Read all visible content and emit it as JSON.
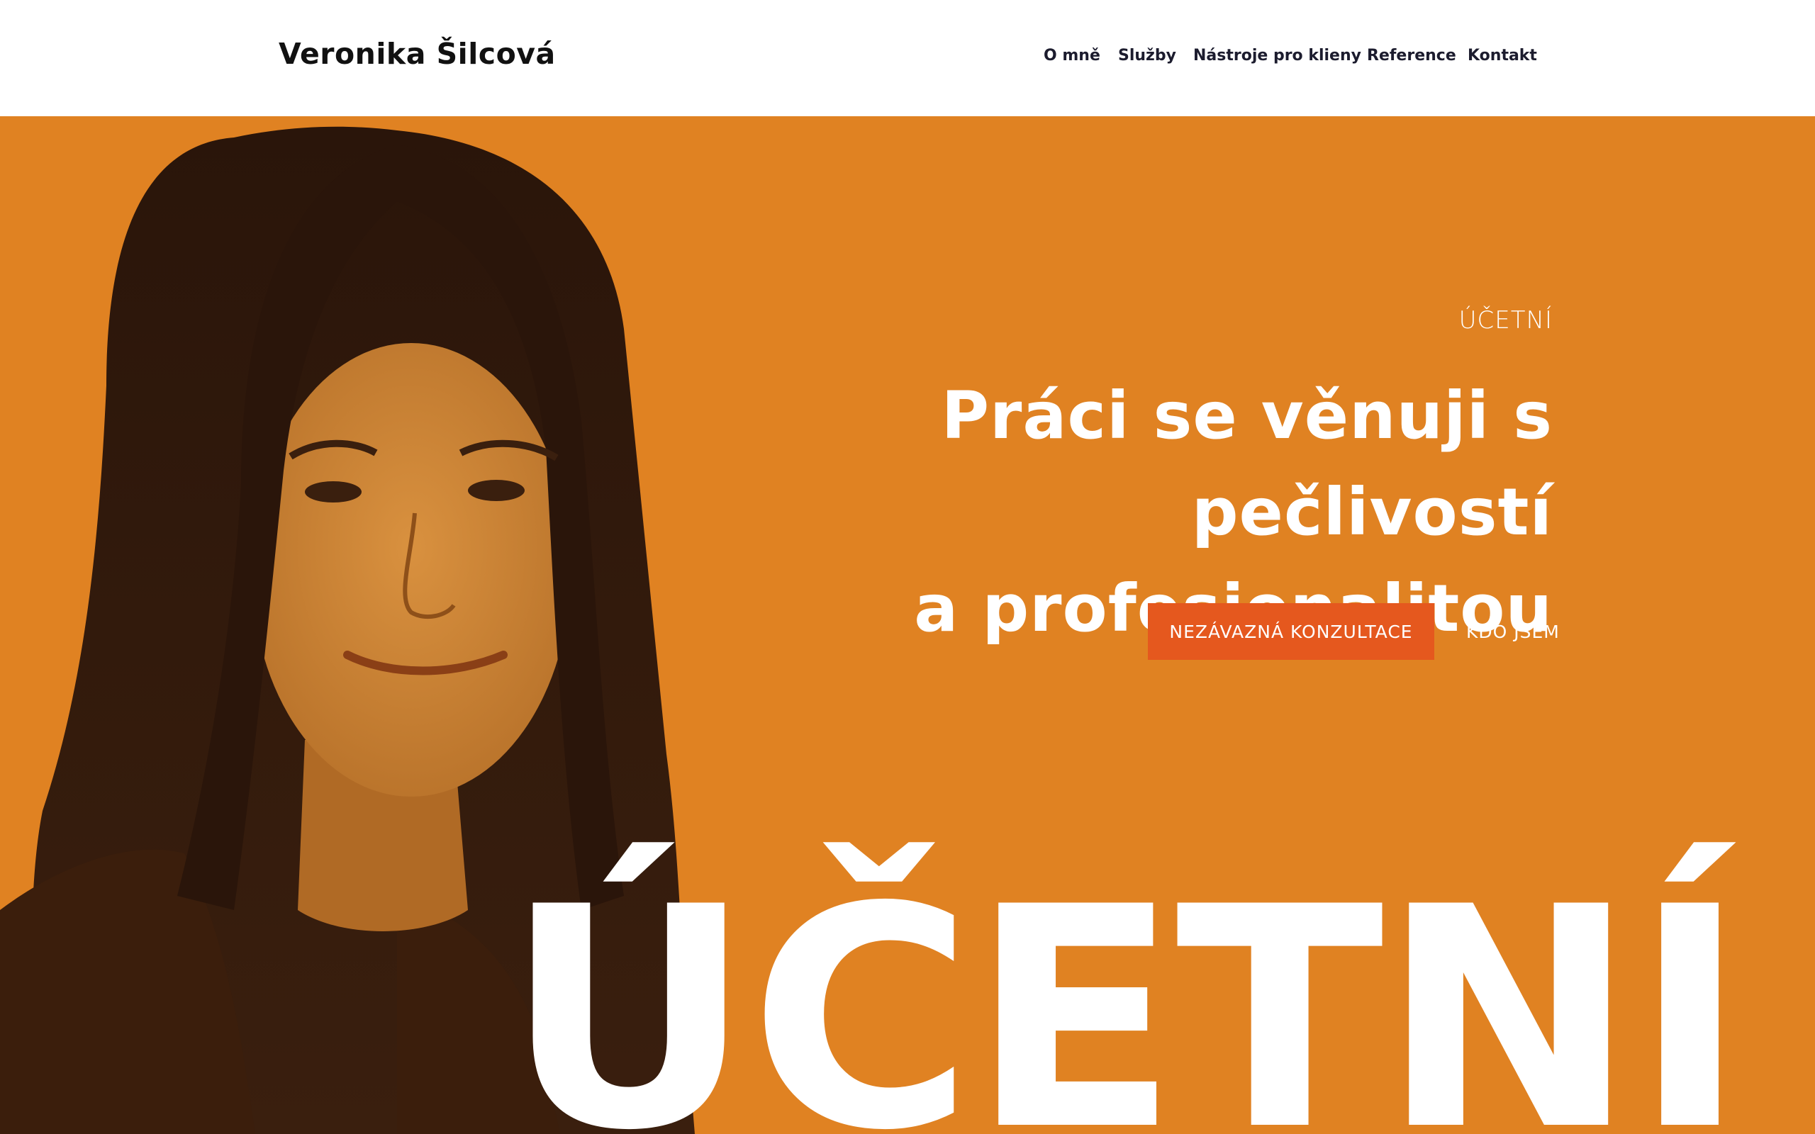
{
  "header": {
    "logo": "Veronika Šilcová",
    "nav": [
      "O mně",
      "Služby",
      "Nástroje pro klieny",
      "Reference",
      "Kontakt"
    ]
  },
  "hero": {
    "eyebrow": "ÚČETNÍ",
    "headline_line1": "Práci se věnuji s pečlivostí",
    "headline_line2": "a profesionalitou",
    "primary_cta": "NEZÁVAZNÁ KONZULTACE",
    "secondary_cta": "KDO JSEM",
    "big_word": "ÚČETNÍ"
  },
  "colors": {
    "background": "#e08222",
    "button": "#e5581e",
    "header": "#ffffff",
    "text_light": "#ffffff",
    "text_dark": "#111111"
  }
}
